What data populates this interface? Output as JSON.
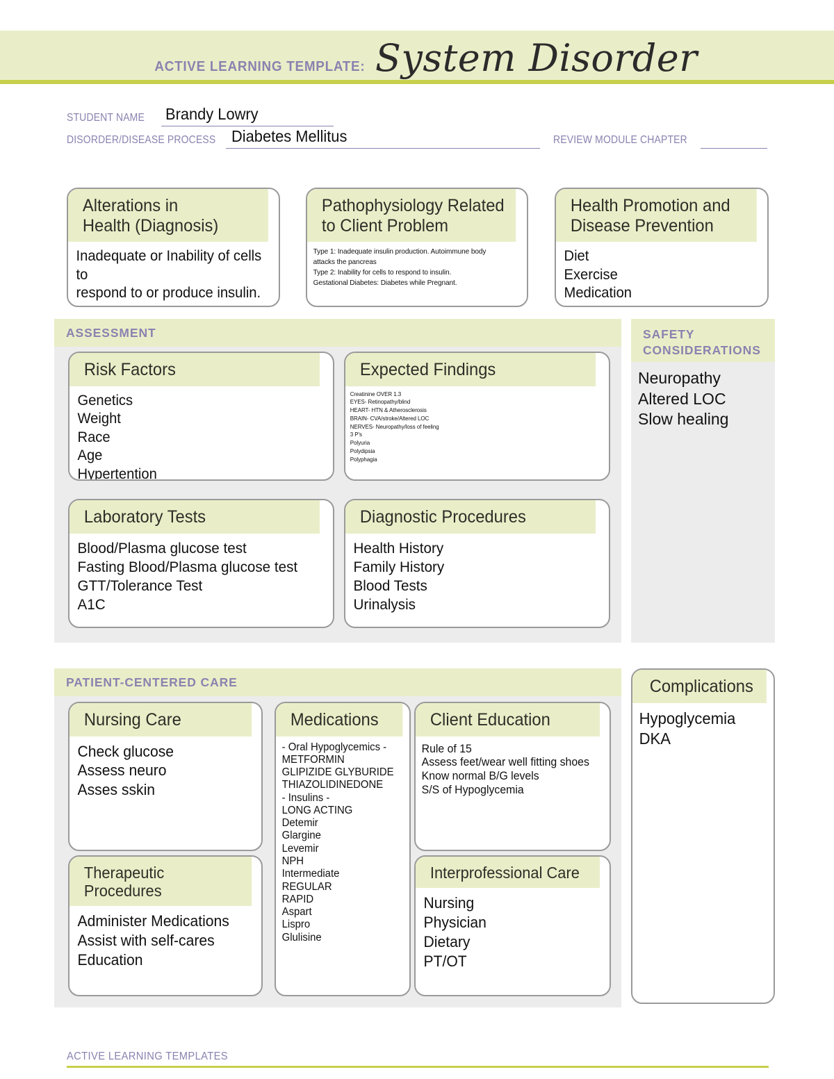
{
  "header": {
    "kicker": "ACTIVE LEARNING TEMPLATE:",
    "title": "System Disorder"
  },
  "identification": {
    "student_name_label": "STUDENT NAME",
    "student_name_value": "Brandy Lowry",
    "disorder_label": "DISORDER/DISEASE PROCESS",
    "disorder_value": "Diabetes Mellitus",
    "review_chapter_label": "REVIEW MODULE CHAPTER",
    "review_chapter_value": ""
  },
  "top_boxes": {
    "alterations": {
      "title": "Alterations in\nHealth (Diagnosis)",
      "body": " Inadequate or Inability of cells to\nrespond to or produce insulin."
    },
    "pathophysiology": {
      "title": "Pathophysiology Related\nto Client Problem",
      "body": "Type 1: Inadequate insulin production. Autoimmune body\nattacks the pancreas\nType 2: Inability for cells to respond to insulin.\nGestational Diabetes: Diabetes while Pregnant."
    },
    "health_promotion": {
      "title": "Health Promotion and\nDisease Prevention",
      "body": "Diet\nExercise\nMedication"
    }
  },
  "assessment": {
    "heading": "ASSESSMENT",
    "risk_factors": {
      "title": "Risk Factors",
      "body": "Genetics\nWeight\nRace\nAge\nHypertention\nHyperlipidimia"
    },
    "expected_findings": {
      "title": "Expected Findings",
      "body": "Creatinine OVER 1.3\nEYES- Retinopathy/blind\nHEART- HTN & Atherosclerosis\nBRAIN- CVA/stroke/Altered LOC\nNERVES- Neuropathy/loss of feeling\n3 P's\n Polyuria\n Polydipsia\n Polyphagia"
    },
    "laboratory_tests": {
      "title": "Laboratory Tests",
      "body": "Blood/Plasma glucose test\nFasting Blood/Plasma glucose test\nGTT/Tolerance Test\nA1C"
    },
    "diagnostic_procedures": {
      "title": "Diagnostic Procedures",
      "body": "Health History\nFamily History\nBlood Tests\nUrinalysis"
    }
  },
  "safety": {
    "heading": "SAFETY\nCONSIDERATIONS",
    "body": "Neuropathy\nAltered LOC\nSlow healing"
  },
  "complications": {
    "title": "Complications",
    "body": "Hypoglycemia\nDKA"
  },
  "patient_centered_care": {
    "heading": "PATIENT-CENTERED CARE",
    "nursing_care": {
      "title": "Nursing Care",
      "body": "Check glucose\nAssess neuro\nAsses sskin"
    },
    "medications": {
      "title": "Medications",
      "body": "- Oral Hypoglycemics -\nMETFORMIN\nGLIPIZIDE GLYBURIDE\nTHIAZOLIDINEDONE\n- Insulins -\nLONG ACTING\n Detemir\n Glargine\n Levemir\nNPH\n Intermediate\nREGULAR\nRAPID\n Aspart\n Lispro\n Glulisine"
    },
    "client_education": {
      "title": "Client Education",
      "body": "Rule of 15\nAssess feet/wear well fitting shoes\nKnow normal B/G levels\nS/S of Hypoglycemia"
    },
    "therapeutic_procedures": {
      "title": "Therapeutic Procedures",
      "body": "Administer Medications\nAssist with self-cares\nEducation"
    },
    "interprofessional_care": {
      "title": "Interprofessional Care",
      "body": "Nursing\nPhysician\nDietary\nPT/OT"
    }
  },
  "footer": {
    "text": "ACTIVE LEARNING TEMPLATES"
  },
  "colors": {
    "banner_bg": "#eaeec8",
    "accent_rule": "#c7d04a",
    "label_purple": "#8b82b0",
    "panel_grey": "#ececec",
    "card_border": "#9a9a9a"
  }
}
